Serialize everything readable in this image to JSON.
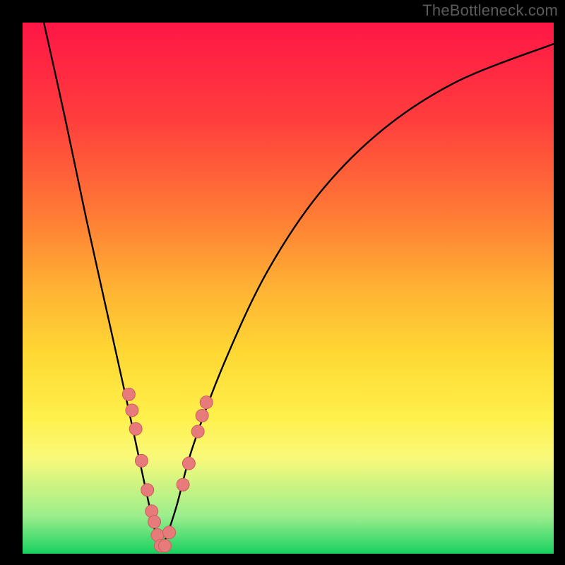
{
  "watermark": "TheBottleneck.com",
  "colors": {
    "frame": "#000000",
    "curve": "#000000",
    "dot_fill": "#e77a7a",
    "dot_stroke": "#cf5d5d"
  },
  "chart_data": {
    "type": "line",
    "title": "",
    "xlabel": "",
    "ylabel": "",
    "xlim": [
      0,
      100
    ],
    "ylim": [
      0,
      100
    ],
    "note": "No axes or tick labels shown. Values are estimated from pixel positions: x ≈ horizontal %, y ≈ curve height % (0 at bottom, 100 at top). Curve looks like a steep V/funnel bottoming near x≈26.",
    "series": [
      {
        "name": "bottleneck-curve",
        "x": [
          4,
          8,
          12,
          16,
          20,
          23,
          25,
          26,
          27,
          29,
          32,
          38,
          46,
          56,
          68,
          82,
          100
        ],
        "y": [
          100,
          82,
          63,
          45,
          27,
          13,
          4,
          1,
          3,
          9,
          20,
          36,
          53,
          68,
          80,
          89,
          96
        ]
      }
    ],
    "highlight_dots": {
      "name": "sample-points",
      "comment": "Pink bead-like markers clustered along the lower V region of the curve",
      "points": [
        {
          "x": 20.0,
          "y": 30.0
        },
        {
          "x": 20.6,
          "y": 27.0
        },
        {
          "x": 21.3,
          "y": 23.5
        },
        {
          "x": 22.4,
          "y": 17.5
        },
        {
          "x": 23.5,
          "y": 12.0
        },
        {
          "x": 24.3,
          "y": 8.0
        },
        {
          "x": 24.8,
          "y": 6.0
        },
        {
          "x": 25.4,
          "y": 3.5
        },
        {
          "x": 26.0,
          "y": 1.5
        },
        {
          "x": 26.8,
          "y": 1.5
        },
        {
          "x": 27.6,
          "y": 4.0
        },
        {
          "x": 30.2,
          "y": 13.0
        },
        {
          "x": 31.3,
          "y": 17.0
        },
        {
          "x": 33.0,
          "y": 23.0
        },
        {
          "x": 33.8,
          "y": 26.0
        },
        {
          "x": 34.6,
          "y": 28.5
        }
      ]
    }
  }
}
